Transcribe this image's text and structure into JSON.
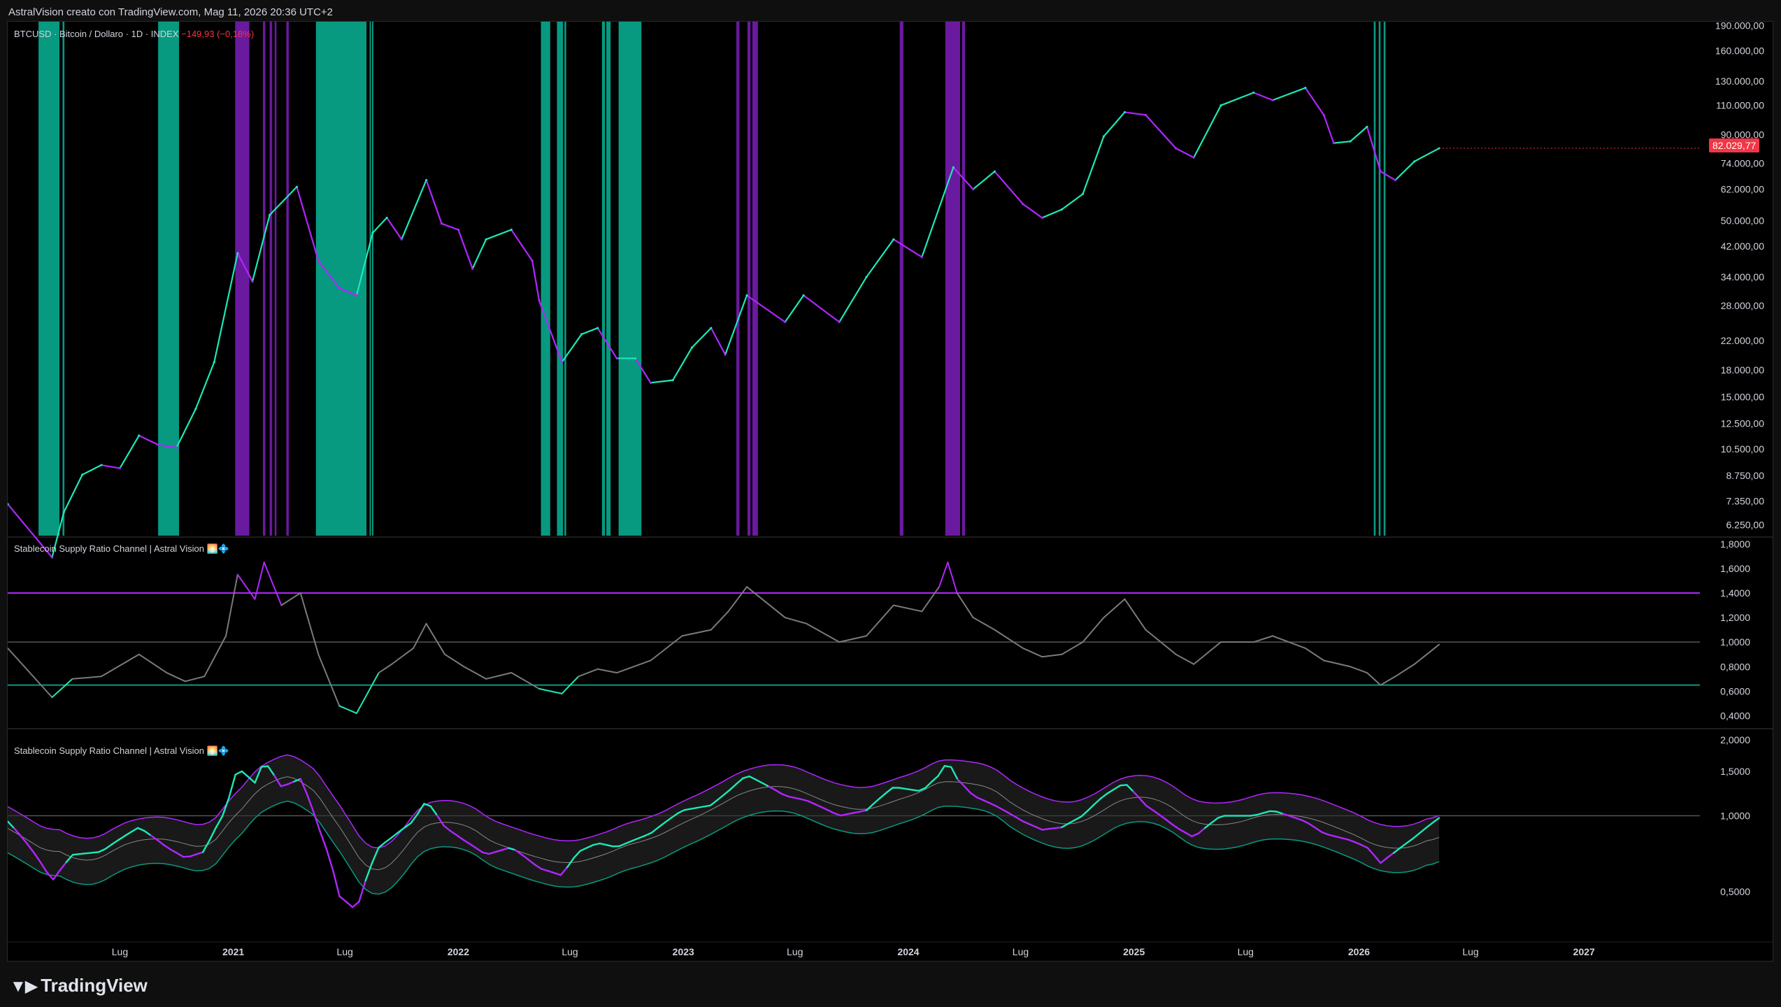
{
  "header": {
    "credit": "AstralVision creato con TradingView.com, Mag 11, 2026 20:36 UTC+2"
  },
  "footer": {
    "brand": "TradingView",
    "logo_icon": "tradingview-logo-icon"
  },
  "colors": {
    "bull": "#1de9b6",
    "bear": "#b026ff",
    "bull_zone": "#089981",
    "bear_zone": "#6a1a9e",
    "grid": "#3a3a3a",
    "neutral": "#7a7a7a",
    "last_price": "#f23645"
  },
  "chart_data": [
    {
      "type": "line",
      "pane": "price",
      "symbol_label": "BTCUSD · Bitcoin / Dollaro · 1D · INDEX",
      "change_label": "−149,93 (−0,18%)",
      "last_price_label": "82.029,77",
      "last_price": 82029.77,
      "scale": "log",
      "ylim": [
        5800,
        195000
      ],
      "y_ticks": [
        190000,
        160000,
        130000,
        110000,
        90000,
        74000,
        62000,
        50000,
        42000,
        34000,
        28000,
        22000,
        18000,
        15000,
        12500,
        10500,
        8750,
        7350,
        6250
      ],
      "y_tick_labels": [
        "190.000,00",
        "160.000,00",
        "130.000,00",
        "110.000,00",
        "90.000,00",
        "74.000,00",
        "62.000,00",
        "50.000,00",
        "42.000,00",
        "34.000,00",
        "28.000,00",
        "22.000,00",
        "18.000,00",
        "15.000,00",
        "12.500,00",
        "10.500,00",
        "8.750,00",
        "7.350,00",
        "6.250,00"
      ],
      "x": [
        "2020-01-01",
        "2020-03-13",
        "2020-04-01",
        "2020-05-01",
        "2020-06-01",
        "2020-07-01",
        "2020-08-01",
        "2020-09-01",
        "2020-10-01",
        "2020-11-01",
        "2020-12-01",
        "2021-01-08",
        "2021-02-01",
        "2021-03-01",
        "2021-04-14",
        "2021-05-19",
        "2021-06-22",
        "2021-07-20",
        "2021-08-15",
        "2021-09-07",
        "2021-10-01",
        "2021-11-10",
        "2021-12-05",
        "2022-01-01",
        "2022-01-24",
        "2022-02-15",
        "2022-03-28",
        "2022-05-01",
        "2022-05-12",
        "2022-06-18",
        "2022-07-20",
        "2022-08-15",
        "2022-09-15",
        "2022-10-15",
        "2022-11-09",
        "2022-12-15",
        "2023-01-15",
        "2023-02-15",
        "2023-03-10",
        "2023-04-14",
        "2023-06-15",
        "2023-07-15",
        "2023-09-11",
        "2023-10-25",
        "2023-12-08",
        "2024-01-23",
        "2024-03-14",
        "2024-04-15",
        "2024-05-20",
        "2024-07-05",
        "2024-08-05",
        "2024-09-06",
        "2024-10-10",
        "2024-11-13",
        "2024-12-17",
        "2025-01-20",
        "2025-03-10",
        "2025-04-08",
        "2025-05-22",
        "2025-07-14",
        "2025-08-14",
        "2025-10-06",
        "2025-11-05",
        "2025-11-21",
        "2025-12-18",
        "2026-01-14",
        "2026-02-05",
        "2026-03-01",
        "2026-04-01",
        "2026-05-11"
      ],
      "values": [
        7200,
        5000,
        6800,
        8800,
        9400,
        9200,
        11500,
        10800,
        10600,
        13800,
        19000,
        40000,
        33000,
        52000,
        63000,
        38000,
        31500,
        30000,
        46000,
        51000,
        44000,
        66000,
        49000,
        47000,
        36000,
        44000,
        47000,
        38000,
        29000,
        19000,
        23000,
        24000,
        19500,
        19500,
        16500,
        16800,
        21000,
        24000,
        20000,
        30000,
        25000,
        30000,
        25000,
        34000,
        44000,
        39000,
        72000,
        62000,
        70000,
        56000,
        51000,
        54000,
        60000,
        89000,
        105000,
        103000,
        82000,
        77000,
        110000,
        120000,
        114000,
        124000,
        103000,
        85000,
        86000,
        95000,
        70000,
        66000,
        75000,
        82030
      ]
    },
    {
      "type": "line",
      "pane": "ratio",
      "title": "Stablecoin Supply Ratio Channel | Astral Vision 🌅💠",
      "upper_level": 1.4,
      "mid_level": 1.0,
      "lower_level": 0.65,
      "ylim": [
        0.3,
        1.85
      ],
      "y_ticks": [
        1.8,
        1.6,
        1.4,
        1.2,
        1.0,
        0.8,
        0.6,
        0.4
      ],
      "y_tick_labels": [
        "1,8000",
        "1,6000",
        "1,4000",
        "1,2000",
        "1,0000",
        "0,8000",
        "0,6000",
        "0,4000"
      ],
      "x": [
        "2020-01-01",
        "2020-03-13",
        "2020-04-15",
        "2020-06-01",
        "2020-08-01",
        "2020-09-15",
        "2020-10-15",
        "2020-11-15",
        "2020-12-20",
        "2021-01-08",
        "2021-02-05",
        "2021-02-20",
        "2021-03-20",
        "2021-04-20",
        "2021-05-19",
        "2021-06-22",
        "2021-07-20",
        "2021-08-25",
        "2021-09-15",
        "2021-10-20",
        "2021-11-10",
        "2021-12-10",
        "2022-01-10",
        "2022-02-15",
        "2022-03-28",
        "2022-05-12",
        "2022-06-18",
        "2022-07-15",
        "2022-08-15",
        "2022-09-15",
        "2022-11-09",
        "2022-12-30",
        "2023-02-15",
        "2023-03-15",
        "2023-04-14",
        "2023-06-15",
        "2023-07-20",
        "2023-09-11",
        "2023-10-25",
        "2023-12-08",
        "2024-01-23",
        "2024-02-20",
        "2024-03-05",
        "2024-03-20",
        "2024-04-15",
        "2024-05-20",
        "2024-07-05",
        "2024-08-05",
        "2024-09-06",
        "2024-10-10",
        "2024-11-13",
        "2024-12-17",
        "2025-01-20",
        "2025-03-10",
        "2025-04-08",
        "2025-05-22",
        "2025-07-14",
        "2025-08-14",
        "2025-10-06",
        "2025-11-05",
        "2025-12-18",
        "2026-01-14",
        "2026-02-05",
        "2026-03-01",
        "2026-04-01",
        "2026-05-11"
      ],
      "values": [
        0.95,
        0.55,
        0.7,
        0.72,
        0.9,
        0.75,
        0.68,
        0.72,
        1.05,
        1.55,
        1.35,
        1.65,
        1.3,
        1.4,
        0.9,
        0.48,
        0.42,
        0.75,
        0.82,
        0.95,
        1.15,
        0.9,
        0.8,
        0.7,
        0.75,
        0.62,
        0.58,
        0.72,
        0.78,
        0.75,
        0.85,
        1.05,
        1.1,
        1.25,
        1.45,
        1.2,
        1.15,
        1.0,
        1.05,
        1.3,
        1.25,
        1.45,
        1.65,
        1.4,
        1.2,
        1.1,
        0.95,
        0.88,
        0.9,
        1.0,
        1.2,
        1.35,
        1.1,
        0.9,
        0.82,
        1.0,
        1.0,
        1.05,
        0.95,
        0.85,
        0.8,
        0.75,
        0.65,
        0.72,
        0.82,
        0.98
      ]
    },
    {
      "type": "line",
      "pane": "band",
      "title": "Stablecoin Supply Ratio Channel | Astral Vision 🌅💠",
      "scale": "log",
      "ylim": [
        0.35,
        2.2
      ],
      "y_ticks": [
        2.0,
        1.5,
        1.0,
        0.5
      ],
      "y_tick_labels": [
        "2,0000",
        "1,5000",
        "1,0000",
        "0,5000"
      ],
      "mid_level": 1.0
    }
  ],
  "signal_zones": {
    "bull": [
      [
        "2020-02-20",
        "2020-03-25"
      ],
      [
        "2020-03-30",
        "2020-04-02"
      ],
      [
        "2020-09-01",
        "2020-10-05"
      ],
      [
        "2021-05-15",
        "2021-08-05"
      ],
      [
        "2021-08-10",
        "2021-08-12"
      ],
      [
        "2021-08-14",
        "2021-08-16"
      ],
      [
        "2022-05-15",
        "2022-05-30"
      ],
      [
        "2022-06-10",
        "2022-06-20"
      ],
      [
        "2022-06-22",
        "2022-06-25"
      ],
      [
        "2022-08-22",
        "2022-08-27"
      ],
      [
        "2022-08-29",
        "2022-09-05"
      ],
      [
        "2022-09-18",
        "2022-10-25"
      ],
      [
        "2026-01-25",
        "2026-01-28"
      ],
      [
        "2026-02-02",
        "2026-02-05"
      ],
      [
        "2026-02-10",
        "2026-02-13"
      ]
    ],
    "bear": [
      [
        "2021-01-04",
        "2021-01-27"
      ],
      [
        "2021-02-18",
        "2021-02-22"
      ],
      [
        "2021-03-01",
        "2021-03-05"
      ],
      [
        "2021-03-09",
        "2021-03-12"
      ],
      [
        "2021-03-28",
        "2021-04-01"
      ],
      [
        "2023-03-28",
        "2023-04-02"
      ],
      [
        "2023-04-15",
        "2023-04-20"
      ],
      [
        "2023-04-23",
        "2023-05-02"
      ],
      [
        "2023-12-18",
        "2023-12-24"
      ],
      [
        "2024-03-01",
        "2024-03-25"
      ],
      [
        "2024-03-28",
        "2024-04-02"
      ]
    ]
  },
  "x_axis": {
    "ticks": [
      "2020-07-01",
      "2021-01-01",
      "2021-07-01",
      "2022-01-01",
      "2022-07-01",
      "2023-01-01",
      "2023-07-01",
      "2024-01-01",
      "2024-07-01",
      "2025-01-01",
      "2025-07-01",
      "2026-01-01",
      "2026-07-01",
      "2027-01-01"
    ],
    "labels": [
      "Lug",
      "2021",
      "Lug",
      "2022",
      "Lug",
      "2023",
      "Lug",
      "2024",
      "Lug",
      "2025",
      "Lug",
      "2026",
      "Lug",
      "2027"
    ],
    "bold": [
      false,
      true,
      false,
      true,
      false,
      true,
      false,
      true,
      false,
      true,
      false,
      true,
      false,
      true
    ],
    "range": [
      "2020-01-01",
      "2027-07-08"
    ]
  }
}
